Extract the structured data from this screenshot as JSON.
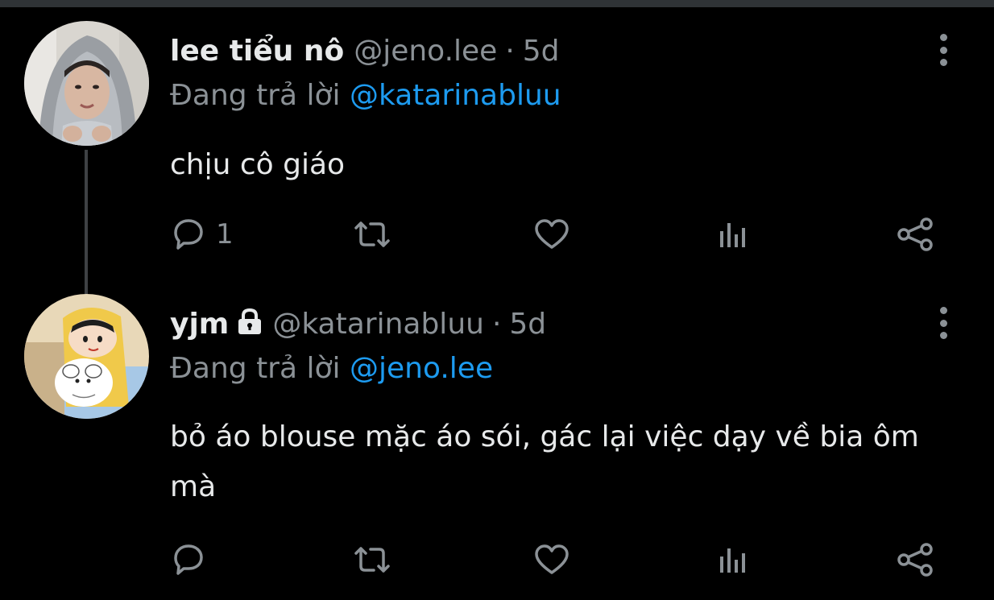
{
  "colors": {
    "background": "#000000",
    "primary_text": "#e7e9ea",
    "secondary_text": "#8b9196",
    "accent": "#1d9bf0",
    "thread_line": "#3e4144"
  },
  "tweets": [
    {
      "display_name": "lee tiểu nô",
      "handle": "@jeno.lee",
      "separator": "·",
      "time": "5d",
      "protected": false,
      "reply_prefix": "Đang trả lời",
      "reply_to": "@katarinabluu",
      "text": "chịu cô giáo",
      "reply_count": "1",
      "icons": [
        "reply-icon",
        "retweet-icon",
        "like-icon",
        "stats-icon",
        "share-icon",
        "more-icon"
      ]
    },
    {
      "display_name": "yjm",
      "handle": "@katarinabluu",
      "separator": "·",
      "time": "5d",
      "protected": true,
      "reply_prefix": "Đang trả lời",
      "reply_to": "@jeno.lee",
      "text": "bỏ áo blouse mặc áo sói, gác lại việc dạy về bia ôm mà",
      "reply_count": "",
      "icons": [
        "reply-icon",
        "retweet-icon",
        "like-icon",
        "stats-icon",
        "share-icon",
        "more-icon",
        "lock-icon"
      ]
    }
  ]
}
